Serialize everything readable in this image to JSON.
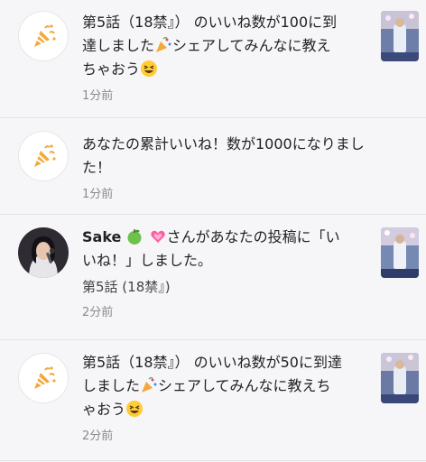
{
  "notifications": [
    {
      "kind": "milestone",
      "text_a": "第5話（18禁』） のいいね数が100に到達しました",
      "text_b": "シェアしてみんなに教えちゃおう",
      "time": "1分前",
      "icon": "party-popper-icon",
      "thumbnail": "post-thumbnail"
    },
    {
      "kind": "milestone",
      "text_a": "あなたの累計いいね！数が1000になりました！",
      "time": "1分前",
      "icon": "party-popper-icon"
    },
    {
      "kind": "like",
      "user": "Sake",
      "text_a": "さんがあなたの投稿に「いいね！」しました。",
      "sub": "第5話 (18禁』)",
      "time": "2分前",
      "icon": "user-avatar",
      "thumbnail": "post-thumbnail"
    },
    {
      "kind": "milestone",
      "text_a": "第5話（18禁』） のいいね数が50に到達しました",
      "text_b": "シェアしてみんなに教えちゃおう",
      "time": "2分前",
      "icon": "party-popper-icon",
      "thumbnail": "post-thumbnail"
    }
  ],
  "colors": {
    "background": "#f6f6f8",
    "time": "#8a8a8e",
    "divider": "#e3e3e6",
    "popper": "#f2a93b"
  }
}
